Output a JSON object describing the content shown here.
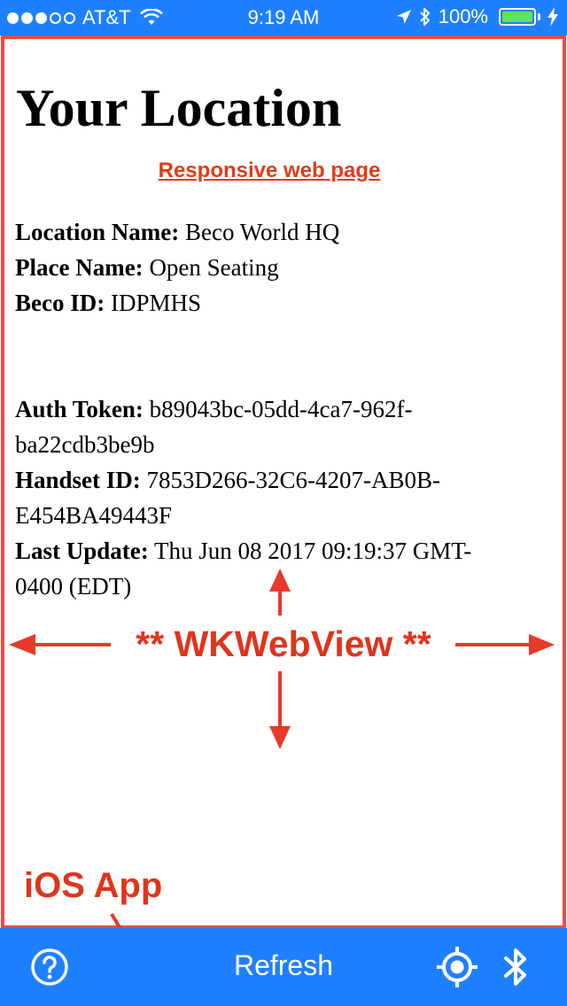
{
  "status_bar": {
    "carrier": "AT&T",
    "time": "9:19 AM",
    "battery_percent": "100%",
    "signal_bars_filled": 3,
    "signal_bars_total": 5,
    "battery_color": "#5ee35a"
  },
  "webpage": {
    "title": "Your Location",
    "link": "Responsive web page",
    "fields": [
      {
        "label": "Location Name:",
        "value": "Beco World HQ"
      },
      {
        "label": "Place Name:",
        "value": "Open Seating"
      },
      {
        "label": "Beco ID:",
        "value": "IDPMHS"
      }
    ],
    "details": [
      {
        "label": "Auth Token:",
        "value": "b89043bc-05dd-4ca7-962f-ba22cdb3be9b"
      },
      {
        "label": "Handset ID:",
        "value": "7853D266-32C6-4207-AB0B-E454BA49443F"
      },
      {
        "label": "Last Update:",
        "value": "Thu Jun 08 2017 09:19:37 GMT-0400 (EDT)"
      }
    ]
  },
  "annotations": {
    "webview_label": "** WKWebView **",
    "app_label": "iOS App",
    "color": "#e0341d"
  },
  "toolbar": {
    "refresh_label": "Refresh",
    "background": "#1f80ff"
  },
  "icons": {
    "help": "help-icon",
    "locate": "locate-icon",
    "bluetooth": "bluetooth-icon"
  }
}
